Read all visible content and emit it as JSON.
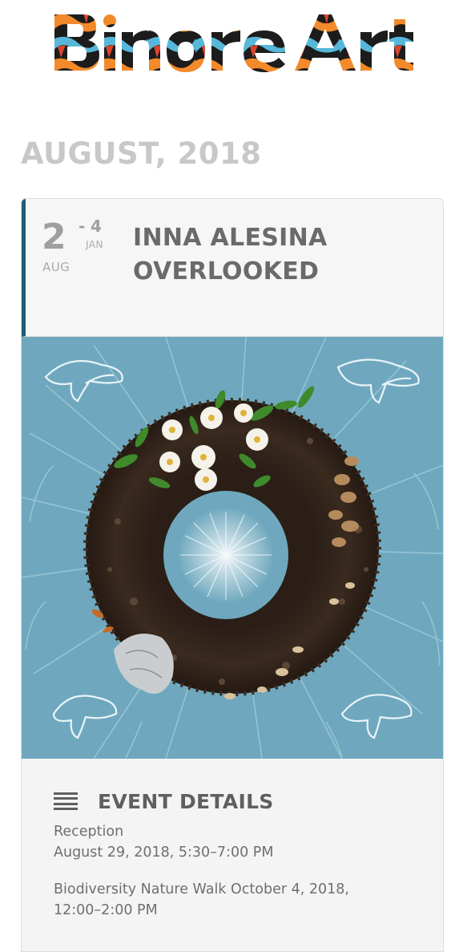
{
  "site": {
    "logo_text": "Binore Art",
    "logo_colors": [
      "#1c1c1c",
      "#f28a2b",
      "#57b7d9",
      "#d9452c"
    ]
  },
  "month_heading": "AUGUST, 2018",
  "event": {
    "start_day": "2",
    "start_month": "AUG",
    "dash": "-",
    "end_day": "4",
    "end_month": "JAN",
    "title_line1": "INNA ALESINA",
    "title_line2": "OVERLOOKED",
    "accent_color": "#1f5d79",
    "image_description_icon": "artwork-soil-wreath"
  },
  "details": {
    "heading": "EVENT DETAILS",
    "icon": "list-icon",
    "items": [
      {
        "line1": "Reception",
        "line2": "August 29, 2018, 5:30–7:00 PM"
      },
      {
        "line1": "Biodiversity Nature Walk October 4, 2018,",
        "line2": "12:00–2:00 PM"
      }
    ]
  }
}
